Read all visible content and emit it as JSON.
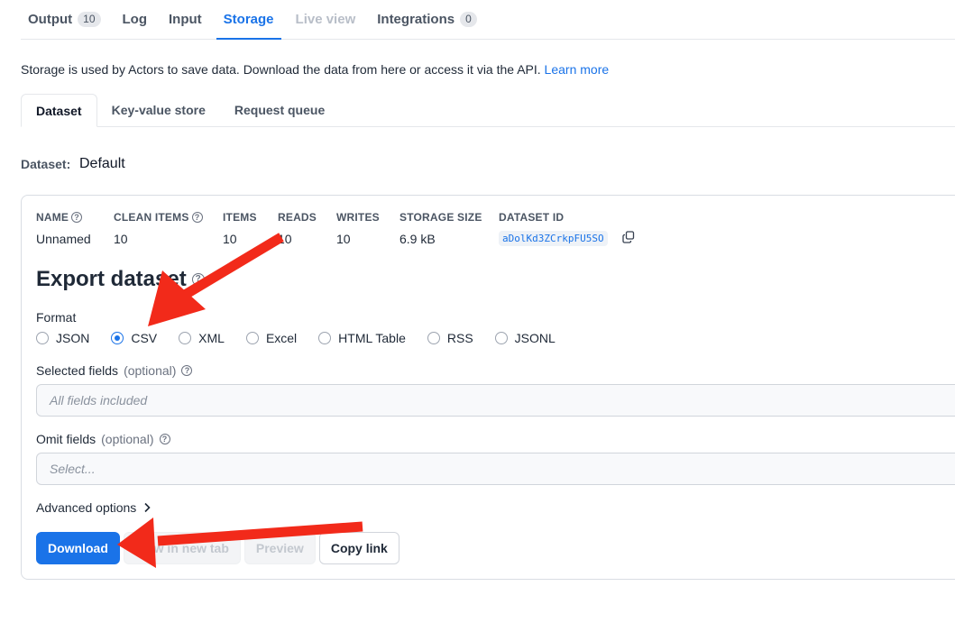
{
  "top_tabs": [
    {
      "label": "Output",
      "count": "10",
      "state": "normal"
    },
    {
      "label": "Log",
      "state": "normal"
    },
    {
      "label": "Input",
      "state": "normal"
    },
    {
      "label": "Storage",
      "state": "active"
    },
    {
      "label": "Live view",
      "state": "disabled"
    },
    {
      "label": "Integrations",
      "count": "0",
      "state": "normal"
    }
  ],
  "info": {
    "text": "Storage is used by Actors to save data. Download the data from here or access it via the API. ",
    "link": "Learn more"
  },
  "sub_tabs": [
    "Dataset",
    "Key-value store",
    "Request queue"
  ],
  "dataset": {
    "label": "Dataset:",
    "value": "Default"
  },
  "meta": {
    "headers": {
      "name": "NAME",
      "clean_items": "CLEAN ITEMS",
      "items": "ITEMS",
      "reads": "READS",
      "writes": "WRITES",
      "storage_size": "STORAGE SIZE",
      "dataset_id": "DATASET ID"
    },
    "values": {
      "name": "Unnamed",
      "clean_items": "10",
      "items": "10",
      "reads": "10",
      "writes": "10",
      "storage_size": "6.9 kB",
      "dataset_id": "aDolKd3ZCrkpFU5SO"
    }
  },
  "export": {
    "title": "Export dataset",
    "format_label": "Format",
    "formats": [
      "JSON",
      "CSV",
      "XML",
      "Excel",
      "HTML Table",
      "RSS",
      "JSONL"
    ],
    "selected_format": "CSV",
    "selected_fields": {
      "label": "Selected fields",
      "optional": "(optional)",
      "placeholder": "All fields included"
    },
    "omit_fields": {
      "label": "Omit fields",
      "optional": "(optional)",
      "placeholder": "Select..."
    },
    "advanced": "Advanced options",
    "buttons": {
      "download": "Download",
      "new_tab": "View in new tab",
      "preview": "Preview",
      "copy_link": "Copy link"
    }
  },
  "colors": {
    "accent": "#1a73e8",
    "annotation_arrow": "#f22a1a"
  }
}
